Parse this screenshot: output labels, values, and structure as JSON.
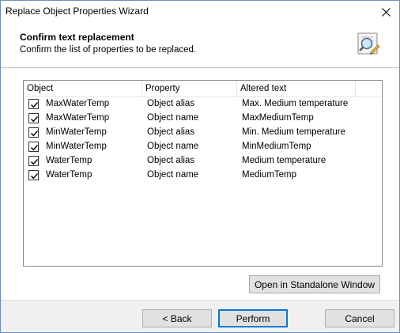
{
  "window": {
    "title": "Replace Object Properties Wizard",
    "close_icon": "close-icon"
  },
  "header": {
    "title": "Confirm text replacement",
    "subtitle": "Confirm the list of properties to be replaced.",
    "icon": "magnifier-edit-icon"
  },
  "list": {
    "columns": [
      "Object",
      "Property",
      "Altered text"
    ],
    "rows": [
      {
        "checked": true,
        "object": "MaxWaterTemp",
        "property": "Object alias",
        "altered": "Max. Medium temperature"
      },
      {
        "checked": true,
        "object": "MaxWaterTemp",
        "property": "Object name",
        "altered": "MaxMediumTemp"
      },
      {
        "checked": true,
        "object": "MinWaterTemp",
        "property": "Object alias",
        "altered": "Min. Medium temperature"
      },
      {
        "checked": true,
        "object": "MinWaterTemp",
        "property": "Object name",
        "altered": "MinMediumTemp"
      },
      {
        "checked": true,
        "object": "WaterTemp",
        "property": "Object alias",
        "altered": "Medium temperature"
      },
      {
        "checked": true,
        "object": "WaterTemp",
        "property": "Object name",
        "altered": "MediumTemp"
      }
    ]
  },
  "buttons": {
    "standalone": "Open in Standalone Window",
    "back": "< Back",
    "perform": "Perform",
    "cancel": "Cancel"
  },
  "colors": {
    "focus_border": "#0078d7",
    "button_bg": "#e1e1e1"
  }
}
